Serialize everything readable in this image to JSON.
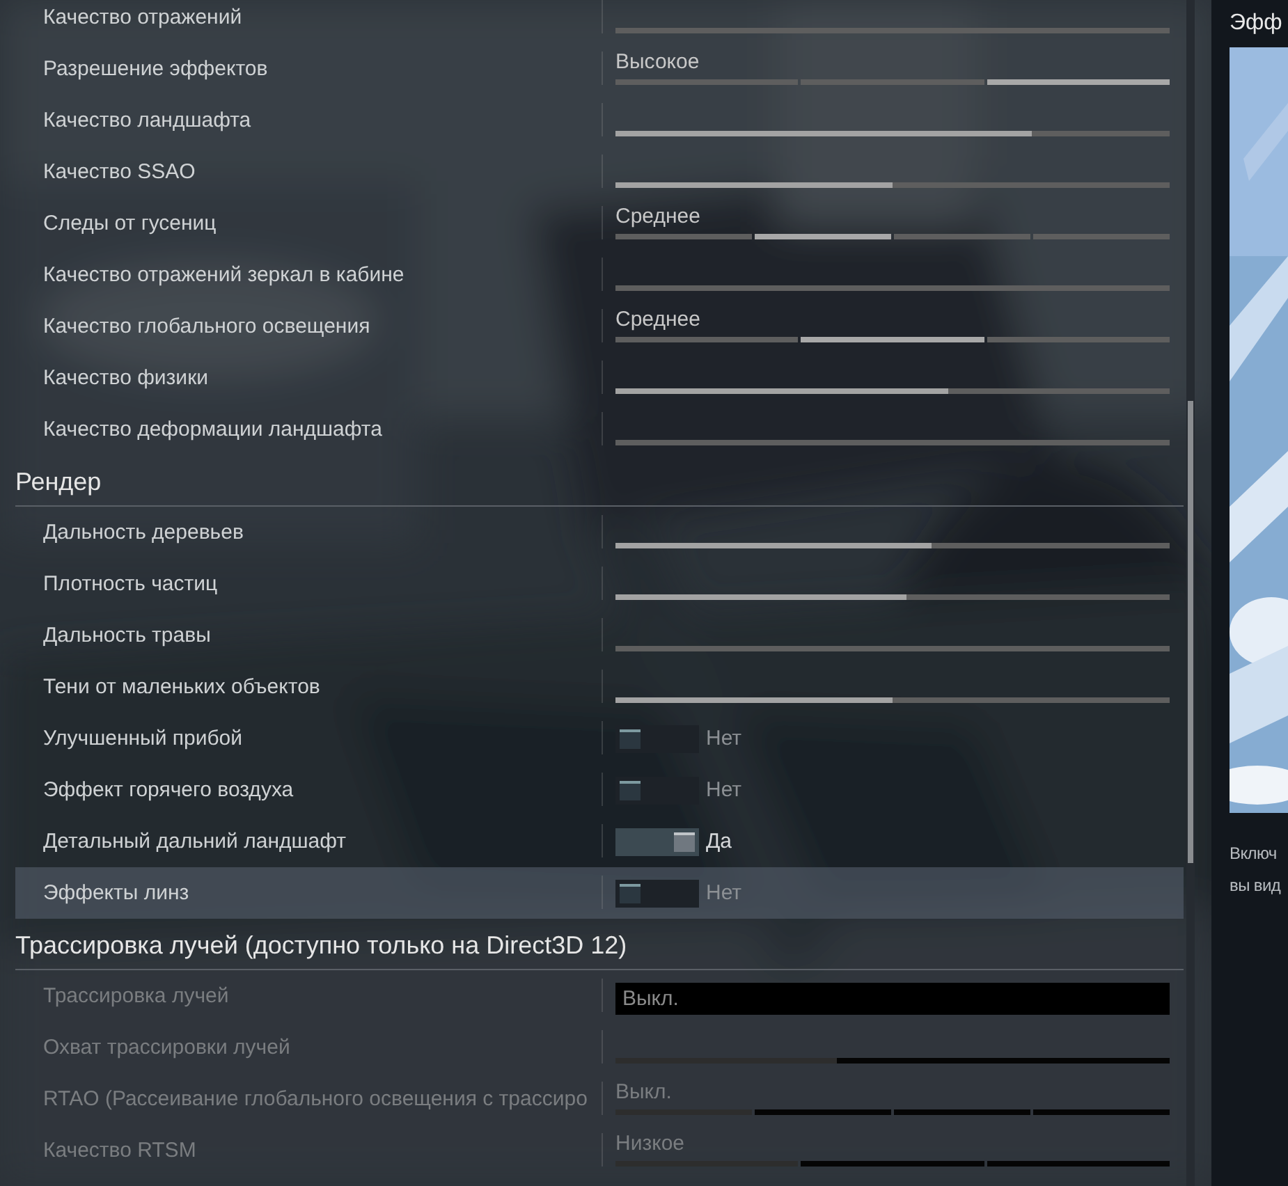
{
  "settings_panel": {
    "sections": [
      {
        "rows": [
          {
            "label": "Качество отражений",
            "kind": "slider",
            "level": 0,
            "disabled": false,
            "hovered": false
          },
          {
            "label": "Разрешение эффектов",
            "kind": "steps",
            "value": "Высокое",
            "steps": [
              {
                "selected": false
              },
              {
                "selected": false
              },
              {
                "selected": true
              }
            ],
            "disabled": false,
            "hovered": false
          },
          {
            "label": "Качество ландшафта",
            "kind": "slider",
            "level": 0.75,
            "disabled": false,
            "hovered": false
          },
          {
            "label": "Качество SSAO",
            "kind": "slider",
            "level": 0.5,
            "disabled": false,
            "hovered": false
          },
          {
            "label": "Следы от гусениц",
            "kind": "steps",
            "value": "Среднее",
            "steps": [
              {
                "selected": false
              },
              {
                "selected": true
              },
              {
                "selected": false
              },
              {
                "selected": false
              }
            ],
            "disabled": false,
            "hovered": false
          },
          {
            "label": "Качество отражений зеркал в кабине",
            "kind": "slider",
            "level": 0,
            "disabled": false,
            "hovered": false
          },
          {
            "label": "Качество глобального освещения",
            "kind": "steps",
            "value": "Среднее",
            "steps": [
              {
                "selected": false
              },
              {
                "selected": true
              },
              {
                "selected": false
              }
            ],
            "disabled": false,
            "hovered": false
          },
          {
            "label": "Качество физики",
            "kind": "slider",
            "level": 0.6,
            "disabled": false,
            "hovered": false
          },
          {
            "label": "Качество деформации ландшафта",
            "kind": "slider",
            "level": 0,
            "disabled": false,
            "hovered": false
          }
        ]
      },
      {
        "title": "Рендер",
        "rows": [
          {
            "label": "Дальность деревьев",
            "kind": "slider",
            "level": 0.57,
            "disabled": false,
            "hovered": false
          },
          {
            "label": "Плотность частиц",
            "kind": "slider",
            "level": 0.525,
            "disabled": false,
            "hovered": false
          },
          {
            "label": "Дальность травы",
            "kind": "slider",
            "level": 0,
            "disabled": false,
            "hovered": false
          },
          {
            "label": "Тени от маленьких объектов",
            "kind": "slider",
            "level": 0.5,
            "disabled": false,
            "hovered": false
          },
          {
            "label": "Улучшенный прибой",
            "kind": "toggle",
            "on": false,
            "value": "Нет",
            "disabled": false,
            "hovered": false
          },
          {
            "label": "Эффект горячего воздуха",
            "kind": "toggle",
            "on": false,
            "value": "Нет",
            "disabled": false,
            "hovered": false
          },
          {
            "label": "Детальный дальний ландшафт",
            "kind": "toggle",
            "on": true,
            "value": "Да",
            "disabled": false,
            "hovered": false
          },
          {
            "label": "Эффекты линз",
            "kind": "toggle",
            "on": false,
            "value": "Нет",
            "disabled": false,
            "hovered": true
          }
        ]
      },
      {
        "title": "Трассировка лучей (доступно только на Direct3D 12)",
        "rows": [
          {
            "label": "Трассировка лучей",
            "kind": "select",
            "value": "Выкл.",
            "disabled": true,
            "hovered": false
          },
          {
            "label": "Охват трассировки лучей",
            "kind": "slider",
            "level": 0.4,
            "disabled": true,
            "hovered": false
          },
          {
            "label": "RTAO (Рассеивание глобального освещения с трассиро",
            "kind": "steps",
            "value": "Выкл.",
            "steps": [
              {
                "selected": true
              },
              {
                "selected": false
              },
              {
                "selected": false
              },
              {
                "selected": false
              }
            ],
            "disabled": true,
            "hovered": false
          },
          {
            "label": "Качество RTSM",
            "kind": "steps",
            "value": "Низкое",
            "steps": [
              {
                "selected": true
              },
              {
                "selected": false
              },
              {
                "selected": false
              }
            ],
            "disabled": true,
            "hovered": false
          }
        ]
      }
    ]
  },
  "info_panel": {
    "title": "Эфф",
    "text_lines": [
      "Включ",
      "вы вид"
    ]
  }
}
